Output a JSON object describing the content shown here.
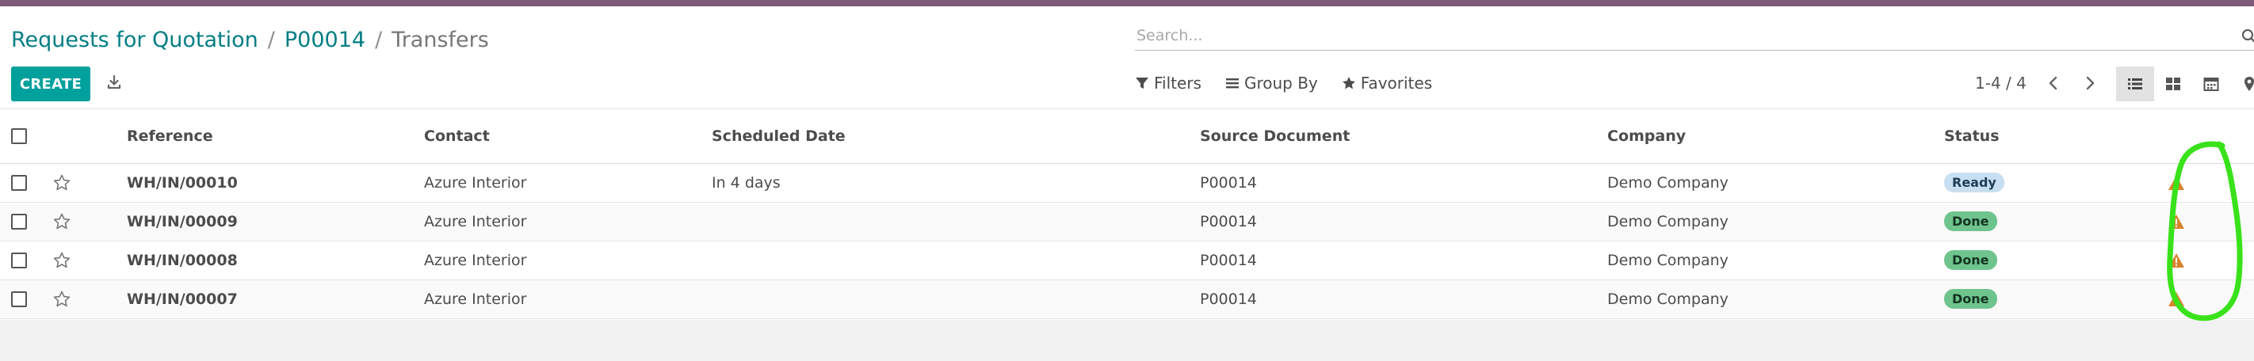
{
  "breadcrumb": {
    "items": [
      "Requests for Quotation",
      "P00014"
    ],
    "current": "Transfers",
    "separator": "/"
  },
  "search": {
    "placeholder": "Search..."
  },
  "toolbar": {
    "create_label": "CREATE"
  },
  "search_options": {
    "filters": "Filters",
    "group_by": "Group By",
    "favorites": "Favorites"
  },
  "pager": {
    "value": "1-4 / 4"
  },
  "views": [
    "list",
    "kanban",
    "calendar",
    "map"
  ],
  "table": {
    "columns": [
      "Reference",
      "Contact",
      "Scheduled Date",
      "Source Document",
      "Company",
      "Status"
    ],
    "rows": [
      {
        "reference": "WH/IN/00010",
        "contact": "Azure Interior",
        "scheduled": "In 4 days",
        "source": "P00014",
        "company": "Demo Company",
        "status": "Ready"
      },
      {
        "reference": "WH/IN/00009",
        "contact": "Azure Interior",
        "scheduled": "",
        "source": "P00014",
        "company": "Demo Company",
        "status": "Done"
      },
      {
        "reference": "WH/IN/00008",
        "contact": "Azure Interior",
        "scheduled": "",
        "source": "P00014",
        "company": "Demo Company",
        "status": "Done"
      },
      {
        "reference": "WH/IN/00007",
        "contact": "Azure Interior",
        "scheduled": "",
        "source": "P00014",
        "company": "Demo Company",
        "status": "Done"
      }
    ]
  },
  "colors": {
    "brand_topbar": "#7c5a78",
    "primary_button": "#00a09d",
    "link": "#017e84",
    "status_ready": "#c7dff0",
    "status_done": "#6fc48e",
    "warning_icon": "#d9822b",
    "annotation_stroke": "#39e21a"
  },
  "icons": {
    "download": "download-icon",
    "search": "search-icon",
    "filters": "filter-icon",
    "group_by": "list-bars-icon",
    "favorites": "star-icon",
    "row_star": "star-outline-icon",
    "row_warning": "warning-icon"
  }
}
